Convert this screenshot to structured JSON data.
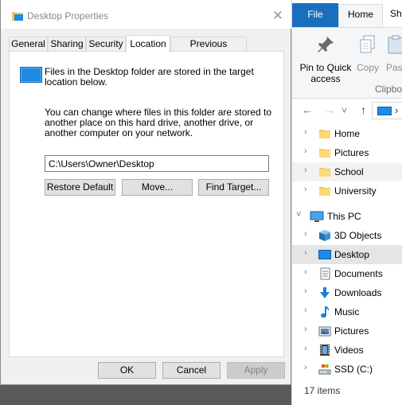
{
  "dialog": {
    "title": "Desktop Properties",
    "close_glyph": "✕",
    "tabs": [
      {
        "label": "General",
        "active": false
      },
      {
        "label": "Sharing",
        "active": false
      },
      {
        "label": "Security",
        "active": false
      },
      {
        "label": "Location",
        "active": true
      },
      {
        "label": "Previous Versions",
        "active": false
      }
    ],
    "location": {
      "intro": "Files in the Desktop folder are stored in the target location below.",
      "description": "You can change where files in this folder are stored to another place on this hard drive, another drive, or another computer on your network.",
      "path_value": "C:\\Users\\Owner\\Desktop",
      "restore_default_label": "Restore Default",
      "move_label": "Move...",
      "find_target_label": "Find Target..."
    },
    "footer": {
      "ok_label": "OK",
      "cancel_label": "Cancel",
      "apply_label": "Apply",
      "apply_enabled": false
    }
  },
  "explorer": {
    "ribbon_tabs": {
      "file": "File",
      "home": "Home",
      "share": "Sh"
    },
    "ribbon": {
      "pin_label": "Pin to Quick access",
      "copy_label": "Copy",
      "paste_label": "Pas",
      "group_label": "Clipbo"
    },
    "nav": {
      "back": "←",
      "forward": "→",
      "recent": "˅",
      "up": "↑",
      "address_chevron": "›"
    },
    "tree": [
      {
        "label": "Home",
        "icon": "folder-icon",
        "expander": "›",
        "selected": false
      },
      {
        "label": "Pictures",
        "icon": "folder-icon",
        "expander": "›",
        "selected": false
      },
      {
        "label": "School",
        "icon": "folder-icon",
        "expander": "›",
        "selected": false
      },
      {
        "label": "University",
        "icon": "folder-icon",
        "expander": "›",
        "selected": false
      },
      {
        "label": "This PC",
        "icon": "monitor-icon",
        "expander": "˅",
        "selected": false
      },
      {
        "label": "3D Objects",
        "icon": "cube-icon",
        "expander": "›",
        "selected": false
      },
      {
        "label": "Desktop",
        "icon": "desktop-icon",
        "expander": "›",
        "selected": true
      },
      {
        "label": "Documents",
        "icon": "document-icon",
        "expander": "›",
        "selected": false
      },
      {
        "label": "Downloads",
        "icon": "download-icon",
        "expander": "›",
        "selected": false
      },
      {
        "label": "Music",
        "icon": "music-icon",
        "expander": "›",
        "selected": false
      },
      {
        "label": "Pictures",
        "icon": "pictures-icon",
        "expander": "›",
        "selected": false
      },
      {
        "label": "Videos",
        "icon": "video-icon",
        "expander": "›",
        "selected": false
      },
      {
        "label": "SSD (C:)",
        "icon": "drive-icon",
        "expander": "›",
        "selected": false
      }
    ],
    "status": "17 items"
  },
  "colors": {
    "accent_blue": "#1a6fbd",
    "folder_yellow": "#f2c55c",
    "desktop_blue": "#1e8ae6",
    "selected_row": "#e5e5e5"
  }
}
